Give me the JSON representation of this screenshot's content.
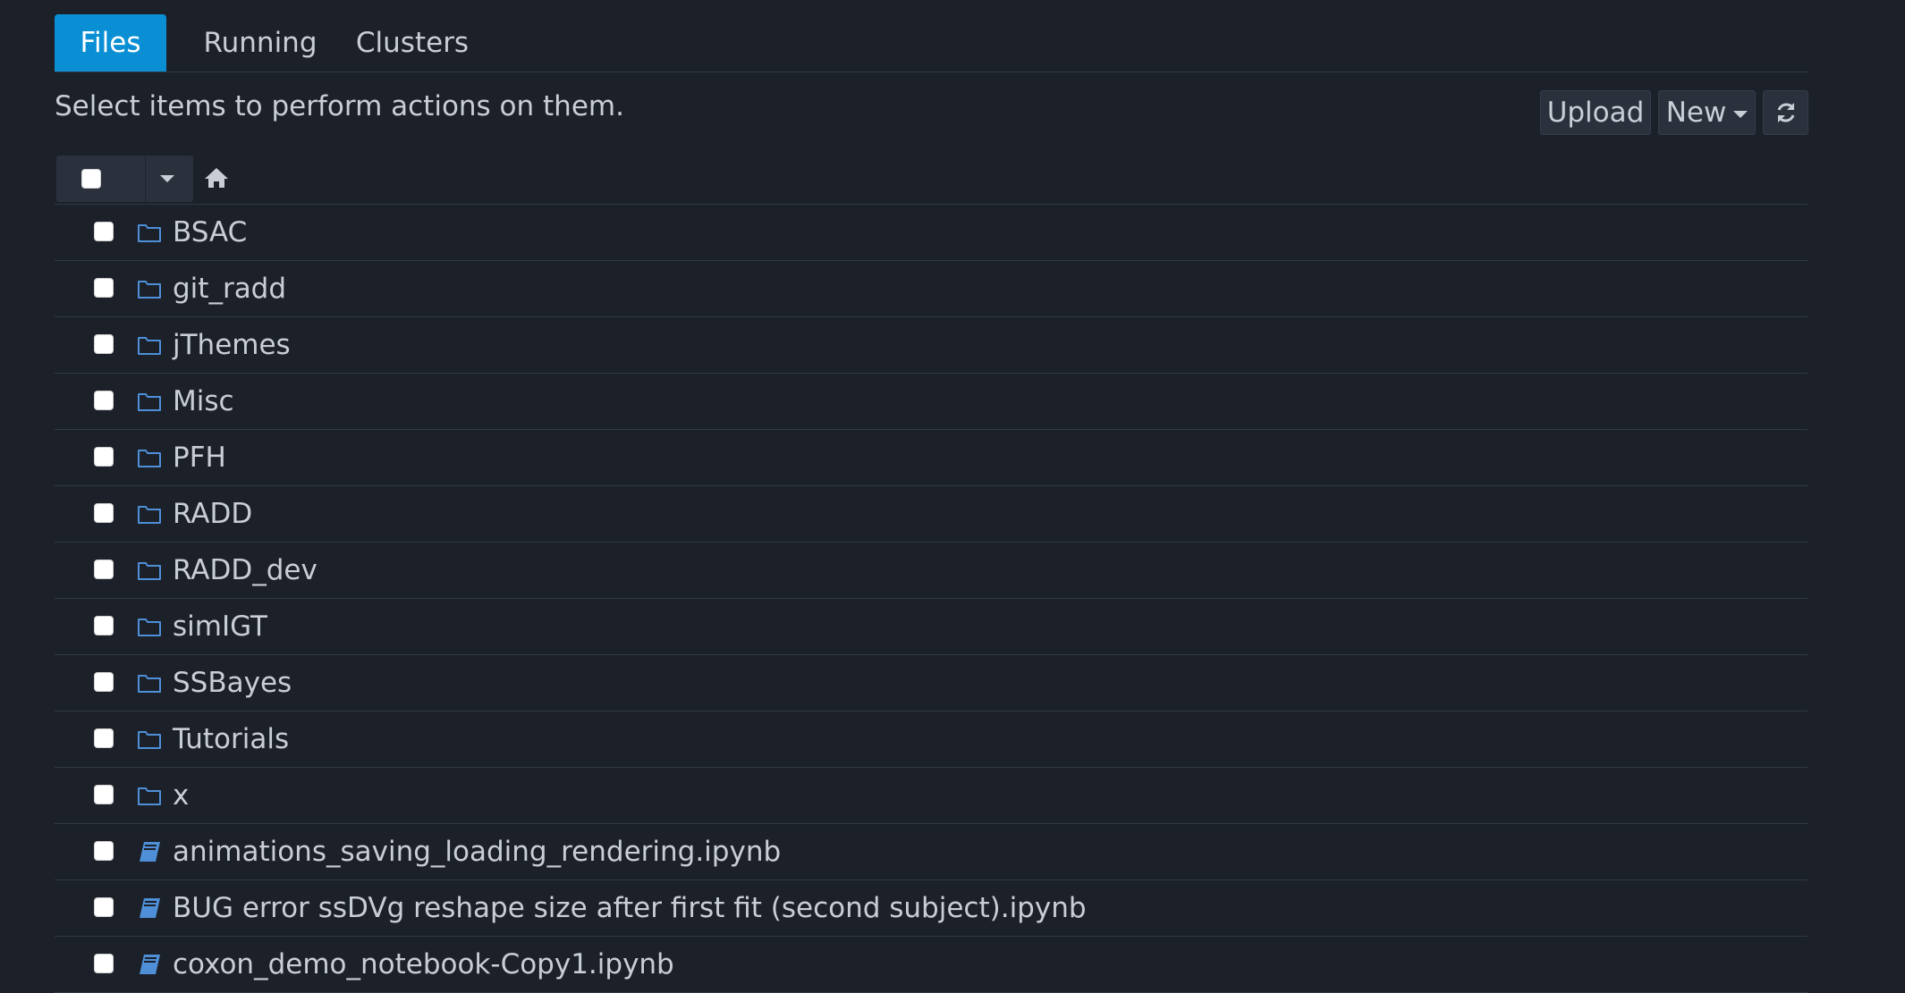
{
  "tabs": [
    {
      "label": "Files",
      "active": true
    },
    {
      "label": "Running",
      "active": false
    },
    {
      "label": "Clusters",
      "active": false
    }
  ],
  "instructions": "Select items to perform actions on them.",
  "toolbar": {
    "upload_label": "Upload",
    "new_label": "New",
    "refresh_icon": "refresh-icon"
  },
  "breadcrumb": {
    "icon": "home-icon"
  },
  "colors": {
    "accent": "#0a8fd4",
    "background": "#1b2029",
    "folder_icon": "#4f8fd8",
    "notebook_icon": "#4f8fd8"
  },
  "items": [
    {
      "name": "BSAC",
      "type": "folder"
    },
    {
      "name": "git_radd",
      "type": "folder"
    },
    {
      "name": "jThemes",
      "type": "folder"
    },
    {
      "name": "Misc",
      "type": "folder"
    },
    {
      "name": "PFH",
      "type": "folder"
    },
    {
      "name": "RADD",
      "type": "folder"
    },
    {
      "name": "RADD_dev",
      "type": "folder"
    },
    {
      "name": "simIGT",
      "type": "folder"
    },
    {
      "name": "SSBayes",
      "type": "folder"
    },
    {
      "name": "Tutorials",
      "type": "folder"
    },
    {
      "name": "x",
      "type": "folder"
    },
    {
      "name": "animations_saving_loading_rendering.ipynb",
      "type": "notebook"
    },
    {
      "name": "BUG error ssDVg reshape size after first fit (second subject).ipynb",
      "type": "notebook"
    },
    {
      "name": "coxon_demo_notebook-Copy1.ipynb",
      "type": "notebook"
    }
  ]
}
